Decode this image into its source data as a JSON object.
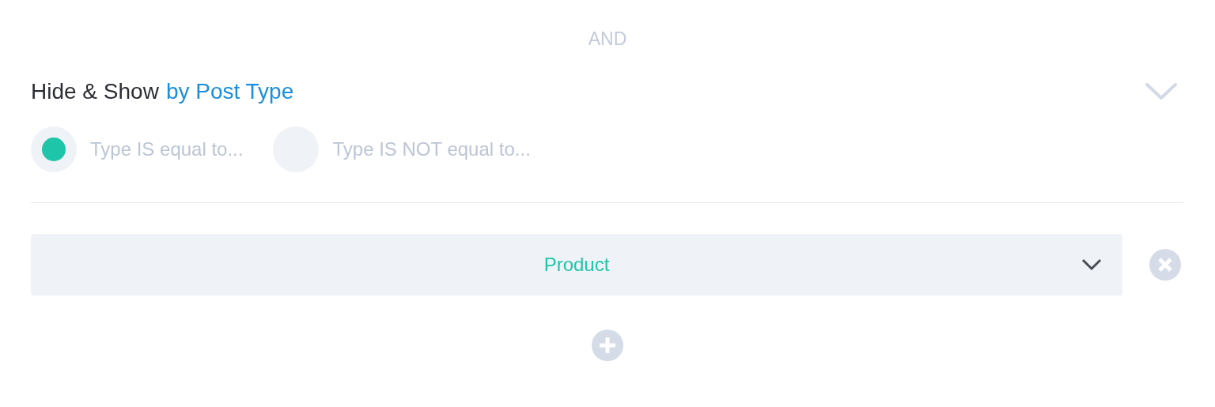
{
  "separator": "AND",
  "heading": {
    "text": "Hide & Show",
    "highlight": "by Post Type"
  },
  "options": [
    {
      "label": "Type IS equal to...",
      "selected": true
    },
    {
      "label": "Type IS NOT equal to...",
      "selected": false
    }
  ],
  "conditions": [
    {
      "value": "Product"
    }
  ]
}
